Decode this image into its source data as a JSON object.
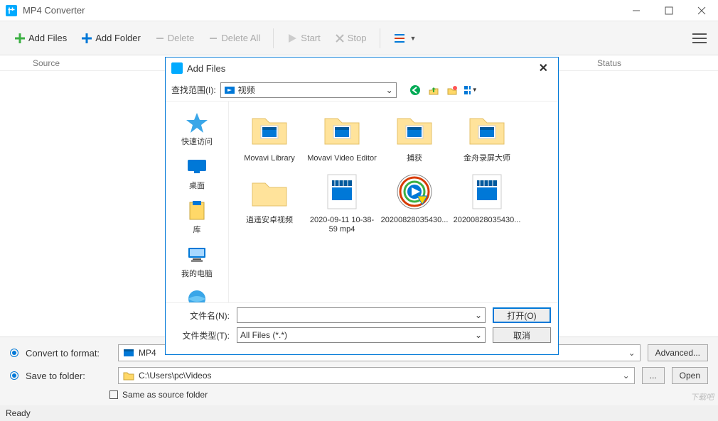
{
  "app": {
    "title": "MP4 Converter"
  },
  "toolbar": {
    "add_files": "Add Files",
    "add_folder": "Add Folder",
    "delete": "Delete",
    "delete_all": "Delete All",
    "start": "Start",
    "stop": "Stop"
  },
  "list": {
    "col_source": "Source",
    "col_status": "Status"
  },
  "convert": {
    "label": "Convert to format:",
    "format": "MP4",
    "advanced": "Advanced..."
  },
  "save": {
    "label": "Save to folder:",
    "path": "C:\\Users\\pc\\Videos",
    "browse": "...",
    "open": "Open",
    "same_as_source": "Same as source folder"
  },
  "status": "Ready",
  "dialog": {
    "title": "Add Files",
    "look_in_label": "查找范围(I):",
    "look_in_value": "视频",
    "places": {
      "quick": "快速访问",
      "desktop": "桌面",
      "libraries": "库",
      "computer": "我的电脑",
      "network": "网络"
    },
    "items": [
      {
        "name": "Movavi Library",
        "type": "folder-video"
      },
      {
        "name": "Movavi Video Editor",
        "type": "folder-video"
      },
      {
        "name": "捕获",
        "type": "folder-video"
      },
      {
        "name": "金舟录屏大师",
        "type": "folder-video"
      },
      {
        "name": "逍遥安卓视频",
        "type": "folder"
      },
      {
        "name": "2020-09-11 10-38-59 mp4",
        "type": "video"
      },
      {
        "name": "20200828035430...",
        "type": "wmp"
      },
      {
        "name": "20200828035430...",
        "type": "video"
      }
    ],
    "file_name_label": "文件名(N):",
    "file_name_value": "",
    "file_type_label": "文件类型(T):",
    "file_type_value": "All Files (*.*)",
    "open_btn": "打开(O)",
    "cancel_btn": "取消"
  },
  "watermark": "下载吧"
}
